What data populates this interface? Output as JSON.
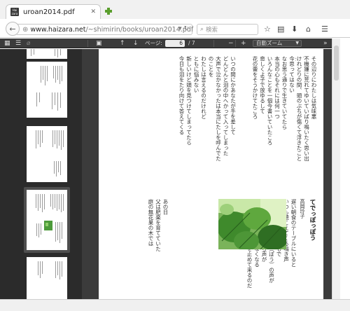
{
  "browser": {
    "tab": {
      "favicon_text": "Hai zara",
      "title": "uroan2014.pdf",
      "close_label": "✕"
    },
    "new_tab_label": "+",
    "address": {
      "host": "www.haizara.net",
      "path": "/~shimirin/books/uroan2014.pdf"
    },
    "search": {
      "placeholder": "検索"
    }
  },
  "pdf_toolbar": {
    "page_label": "ページ:",
    "page_value": "6",
    "page_total": "/ 7",
    "zoom_minus": "−",
    "zoom_plus": "+",
    "zoom_value": "自動ズーム"
  },
  "page": {
    "upper_columns": [
      "その辺りにわたしは気味悪",
      "不機嫌に荒れてゆいていばり鳴いたく思い出す",
      "けれどりの間、頭のぶちが傷くて浮きたことを",
      "今思ってはない",
      "なお思う通りで生きていてたら",
      "本当の心もそれには何一つ",
      "いろんなことを一個今書いていたころ",
      "悲しくよ子で放ゆるして",
      "花の蕾をそうかけてたころ",
      "",
      "",
      "いつの間にかあなたが手を差して",
      "どんどんと泪の中へかって入ってしまった",
      "大声で泣かなかったは本当にたしを呼んでたら",
      "のことを",
      "わたしは言えるのだけれど",
      "ともに悩みない",
      "新しいけど頭を見つけてしまってたら",
      "今日も泪をたり向けて答えてくる"
    ],
    "title_right": "てでっぽっぽう",
    "author_right": "高岡玲子",
    "lower_columns": [
      "遅い朝食のテーブルにいると",
      "いつも聴こえてくる鳴き声",
      "あれは小さな声いつもで",
      "あたしの知らない声（ぽう）の声が",
      "声が聴こえる方向から声が",
      "かたちを小さく心がなくなる",
      "切り方がなしい思いを止めて来るのだ"
    ],
    "lower_left_columns": [
      "あの日",
      "父は肥楽を育てていた",
      "庭の無花果の木では"
    ]
  }
}
